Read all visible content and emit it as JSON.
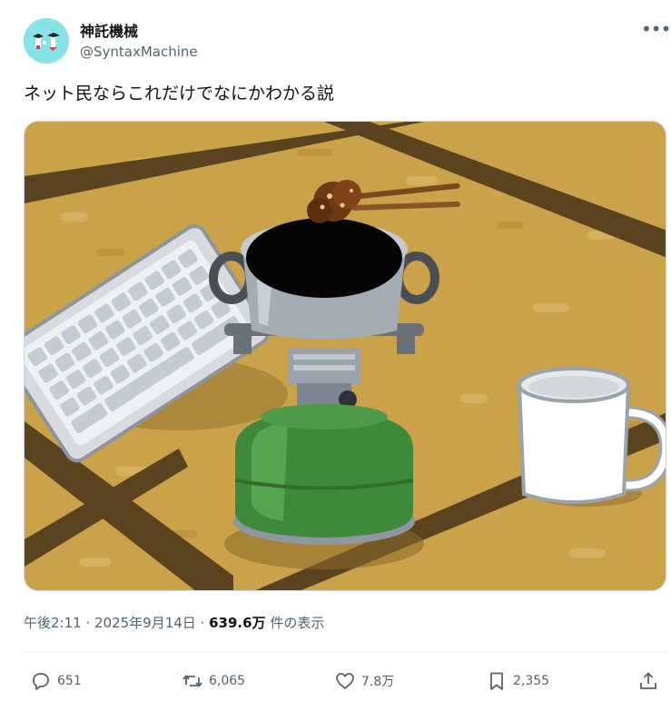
{
  "author": {
    "display_name": "神託機械",
    "handle": "@SyntaxMachine",
    "avatar_icon": "avatar-illustration"
  },
  "post": {
    "text": "ネット民ならこれだけでなにかわかる説",
    "image": {
      "description_icon": "camping-stove-pot-illustration"
    }
  },
  "meta": {
    "time_date": "午後2:11 · 2025年9月14日 · ",
    "views_count": "639.6万",
    "views_suffix": " 件の表示"
  },
  "actions": {
    "replies": "651",
    "reposts": "6,065",
    "likes": "7.8万",
    "bookmarks": "2,355"
  },
  "colors": {
    "accent": "#1d9bf0",
    "secondary_text": "#536471",
    "avatar_bg": "#87e3e6",
    "tatami": "#c9a24a",
    "stove_green": "#3f8a3a"
  }
}
